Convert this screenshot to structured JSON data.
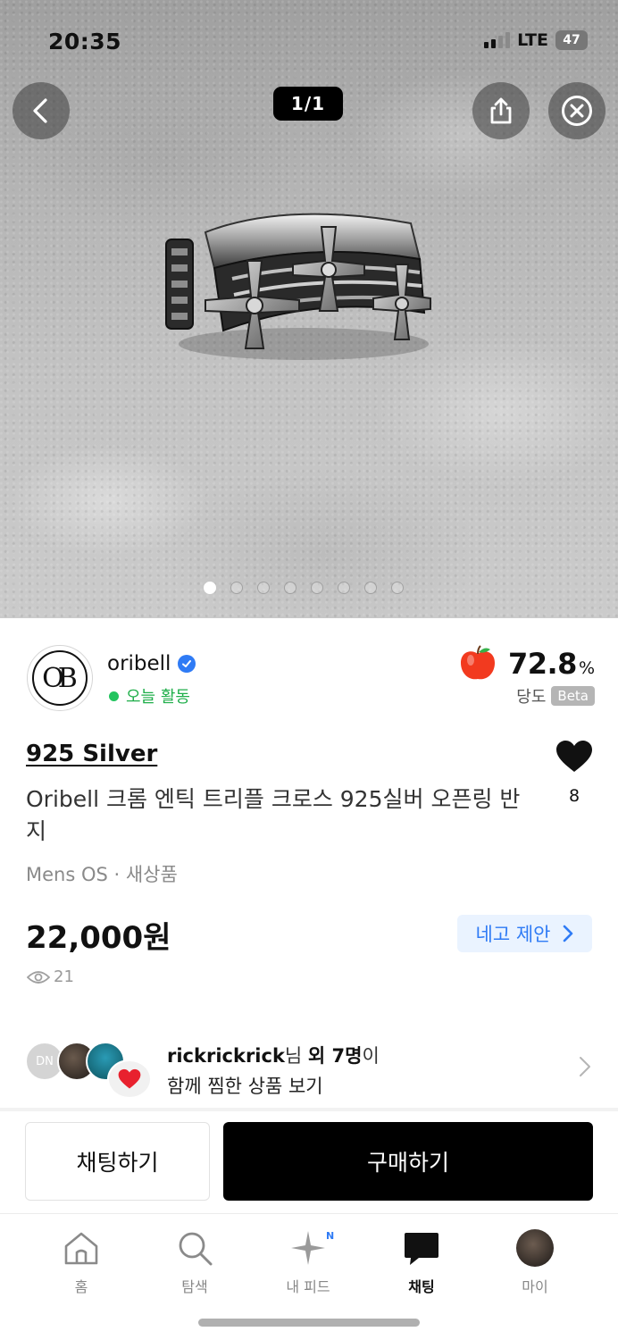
{
  "status_bar": {
    "time": "20:35",
    "network": "LTE",
    "battery": "47"
  },
  "gallery": {
    "counter": "1/1",
    "dots_total": 8,
    "active_dot": 0
  },
  "seller": {
    "logo_text": "OB",
    "name": "oribell",
    "activity": "오늘 활동",
    "temperature_value": "72.8",
    "temperature_unit": "%",
    "temperature_label": "당도",
    "beta_label": "Beta"
  },
  "product": {
    "brand": "925 Silver",
    "title": "Oribell 크롬 엔틱 트리플 크로스 925실버 오픈링 반지",
    "meta": "Mens OS · 새상품",
    "price": "22,000원",
    "offer_label": "네고 제안",
    "views": "21",
    "likes": "8"
  },
  "likers": {
    "first_avatar_initials": "DN",
    "name": "rickrickrick",
    "suffix_a": "님 ",
    "others": "외 7명",
    "suffix_b": "이",
    "line2": "함께 찜한 상품 보기"
  },
  "actions": {
    "chat_label": "채팅하기",
    "buy_label": "구매하기"
  },
  "tabbar": {
    "home": "홈",
    "search": "탐색",
    "feed": "내 피드",
    "feed_badge": "N",
    "chat": "채팅",
    "my": "마이"
  },
  "colors": {
    "accent_blue": "#2f7bf5",
    "activity_green": "#1fae4a",
    "buy_button": "#000000"
  },
  "icons": [
    "back-arrow-icon",
    "share-icon",
    "close-icon",
    "verified-icon",
    "apple-icon",
    "heart-icon",
    "eye-icon",
    "chevron-right-icon",
    "home-icon",
    "search-icon",
    "sparkle-icon",
    "chat-bubble-icon"
  ]
}
